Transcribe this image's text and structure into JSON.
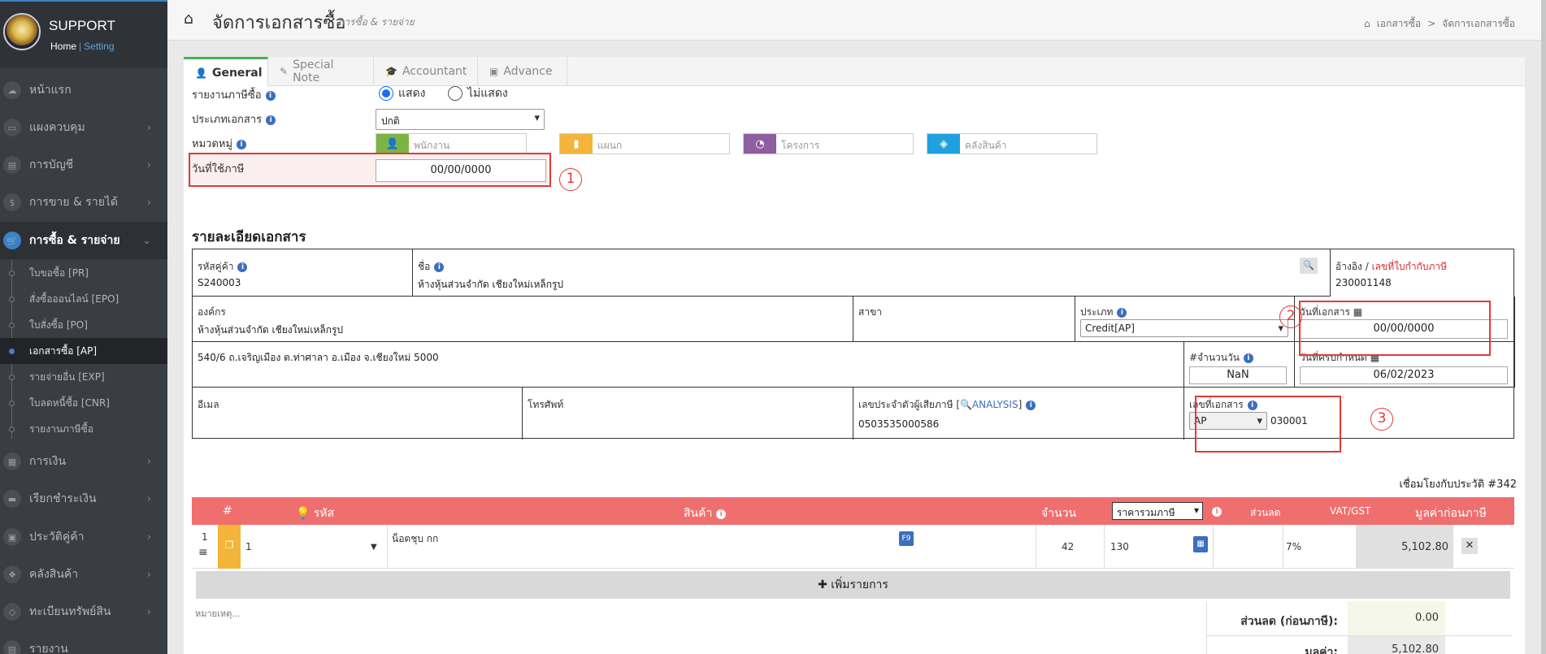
{
  "brand": {
    "title": "SUPPORT",
    "home": "Home",
    "sep": "|",
    "setting": "Setting"
  },
  "nav": [
    {
      "label": "หน้าแรก",
      "icon": "cloud-icon"
    },
    {
      "label": "แผงควบคุม",
      "icon": "monitor-icon"
    },
    {
      "label": "การบัญชี",
      "icon": "book-icon"
    },
    {
      "label": "การขาย & รายได้",
      "icon": "dollar-icon"
    },
    {
      "label": "การซื้อ & รายจ่าย",
      "icon": "cart-icon"
    },
    {
      "label": "การเงิน",
      "icon": "calendar-icon"
    },
    {
      "label": "เรียกชำระเงิน",
      "icon": "card-icon"
    },
    {
      "label": "ประวัติคู่ค้า",
      "icon": "contact-icon"
    },
    {
      "label": "คลังสินค้า",
      "icon": "cubes-icon"
    },
    {
      "label": "ทะเบียนทรัพย์สิน",
      "icon": "diamond-icon"
    },
    {
      "label": "รายงาน",
      "icon": "report-icon"
    }
  ],
  "subnav": [
    "ใบขอซื้อ [PR]",
    "สั่งซื้อออนไลน์ [EPO]",
    "ใบสั่งซื้อ [PO]",
    "เอกสารซื้อ [AP]",
    "รายจ่ายอื่น [EXP]",
    "ใบลดหนี้ซื้อ [CNR]",
    "รายงานภาษีซื้อ"
  ],
  "header": {
    "title": "จัดการเอกสารซื้อ",
    "subtitle": "การซื้อ & รายจ่าย",
    "crumb1": "เอกสารซื้อ",
    "crumb_sep": ">",
    "crumb2": "จัดการเอกสารซื้อ"
  },
  "tabs": [
    "General",
    "Special Note",
    "Accountant",
    "Advance"
  ],
  "form": {
    "tax_report_label": "รายงานภาษีซื้อ",
    "show": "แสดง",
    "hide": "ไม่แสดง",
    "doc_type_label": "ประเภทเอกสาร",
    "doc_type_value": "ปกติ",
    "category_label": "หมวดหมู่",
    "employee_ph": "พนักงาน",
    "department_ph": "แผนก",
    "project_ph": "โครงการ",
    "warehouse_ph": "คลังสินค้า",
    "tax_date_label": "วันที่ใช้ภาษี",
    "tax_date_value": "00/00/0000"
  },
  "details": {
    "section_title": "รายละเอียดเอกสาร",
    "customer_code_label": "รหัสคู่ค้า",
    "customer_code": "S240003",
    "name_label": "ชื่อ",
    "name": "ห้างหุ้นส่วนจำกัด เชียงใหม่เหล็กรูป",
    "ref_label": "อ้างอิง",
    "ref_sep": "/",
    "tax_invoice_label": "เลขที่ใบกำกับภาษี",
    "ref_value": "230001148",
    "org_label": "องค์กร",
    "org": "ห้างหุ้นส่วนจำกัด เชียงใหม่เหล็กรูป",
    "branch_label": "สาขา",
    "type_label": "ประเภท",
    "type_value": "Credit[AP]",
    "doc_date_label": "วันที่เอกสาร",
    "doc_date": "00/00/0000",
    "address": "540/6 ถ.เจริญเมือง ต.ท่าศาลา อ.เมือง จ.เชียงใหม่ 5000",
    "days_label": "#จำนวนวัน",
    "days": "NaN",
    "due_label": "วันที่ครบกำหนด",
    "due": "06/02/2023",
    "email_label": "อีเมล",
    "phone_label": "โทรศัพท์",
    "taxid_label": "เลขประจำตัวผู้เสียภาษี [",
    "analysis": "ANALYSIS",
    "taxid_close": "]",
    "taxid": "0503535000586",
    "docno_label": "เลขที่เอกสาร",
    "docno_prefix": "AP",
    "docno": "030001"
  },
  "link_history": "เชื่อมโยงกับประวัติ #342",
  "table": {
    "headers": {
      "no": "#",
      "code": "รหัส",
      "product": "สินค้า",
      "qty": "จำนวน",
      "price_mode": "ราคารวมภาษี",
      "discount": "ส่วนลด",
      "vat": "VAT/GST",
      "value": "มูลค่าก่อนภาษี"
    },
    "rows": [
      {
        "no": "1",
        "code": "1",
        "product": "น็อตชุบ กก",
        "f9": "F9",
        "qty": "42",
        "price": "130",
        "vat": "7%",
        "value": "5,102.80"
      }
    ],
    "add_row": "เพิ่มรายการ"
  },
  "notes_ph": "หมายเหตุ...",
  "totals": {
    "discount_label": "ส่วนลด (ก่อนภาษี):",
    "discount": "0.00",
    "value_label": "มูลค่า:",
    "value": "5,102.80"
  },
  "markers": [
    "1",
    "2",
    "3"
  ],
  "colors": {
    "accent": "#3b82c4",
    "danger": "#e53935",
    "table_head": "#ef6f6f",
    "employee": "#7cb342",
    "department": "#f2b53a",
    "project": "#8e5ea2",
    "warehouse": "#1ea1de"
  }
}
